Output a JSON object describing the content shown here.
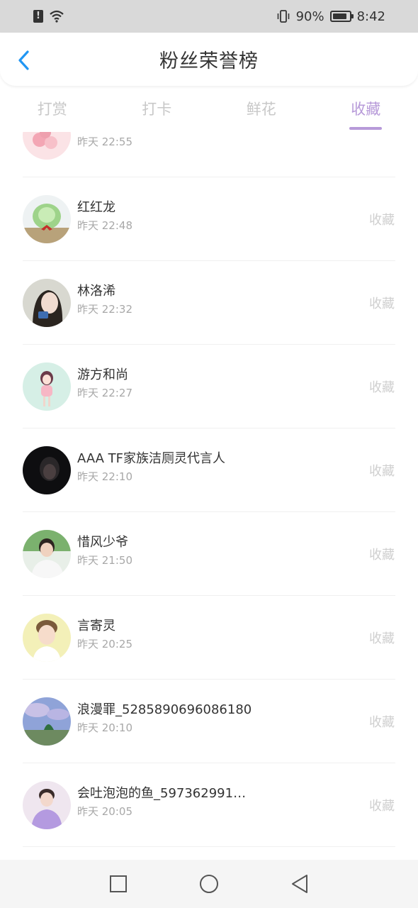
{
  "status_bar": {
    "notification_icon": "alert-icon",
    "wifi_icon": "wifi-icon",
    "vibrate_icon": "vibrate-icon",
    "battery_percent": "90%",
    "battery_level": 0.9,
    "time": "8:42"
  },
  "header": {
    "back_icon": "chevron-left-icon",
    "title": "粉丝荣誉榜",
    "accent_color": "#2196f3"
  },
  "tabs": [
    {
      "label": "打赏",
      "active": false
    },
    {
      "label": "打卡",
      "active": false
    },
    {
      "label": "鲜花",
      "active": false
    },
    {
      "label": "收藏",
      "active": true
    }
  ],
  "accent_color": "#b79ad9",
  "list": [
    {
      "name": "",
      "time": "昨天 22:55",
      "action": "",
      "avatar": "pink-flowers"
    },
    {
      "name": "红红龙",
      "time": "昨天 22:48",
      "action": "收藏",
      "avatar": "cabbage"
    },
    {
      "name": "林洛浠",
      "time": "昨天 22:32",
      "action": "收藏",
      "avatar": "girl-photo"
    },
    {
      "name": "游方和尚",
      "time": "昨天 22:27",
      "action": "收藏",
      "avatar": "cartoon-girl"
    },
    {
      "name": "AAA TF家族洁厕灵代言人",
      "time": "昨天 22:10",
      "action": "收藏",
      "avatar": "dark-portrait"
    },
    {
      "name": "惜风少爷",
      "time": "昨天 21:50",
      "action": "收藏",
      "avatar": "boy-outdoor"
    },
    {
      "name": "言寄灵",
      "time": "昨天 20:25",
      "action": "收藏",
      "avatar": "boy-yellow"
    },
    {
      "name": "浪漫罪_5285890696086180",
      "time": "昨天 20:10",
      "action": "收藏",
      "avatar": "sky-landscape"
    },
    {
      "name": "会吐泡泡的鱼_597362991…",
      "time": "昨天 20:05",
      "action": "收藏",
      "avatar": "boy-purple"
    }
  ],
  "nav_bar": {
    "recent_icon": "square-icon",
    "home_icon": "circle-icon",
    "back_icon": "triangle-back-icon"
  }
}
